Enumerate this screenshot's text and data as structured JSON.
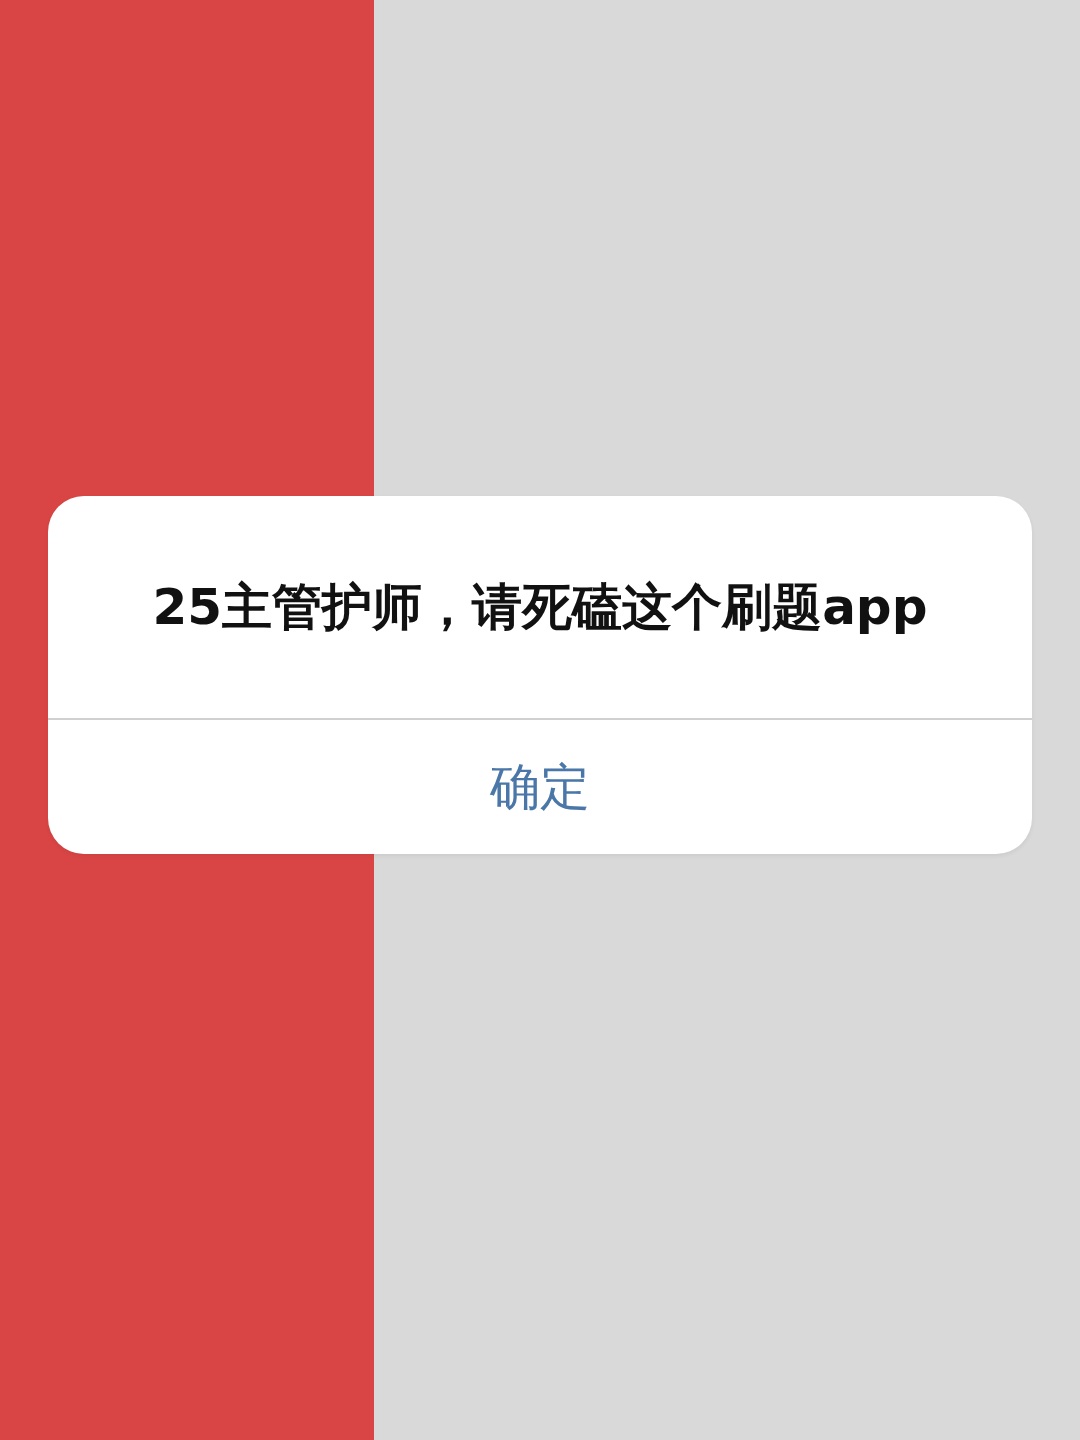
{
  "alert": {
    "title": "25主管护师，请死磕这个刷题app",
    "button": "确定"
  }
}
